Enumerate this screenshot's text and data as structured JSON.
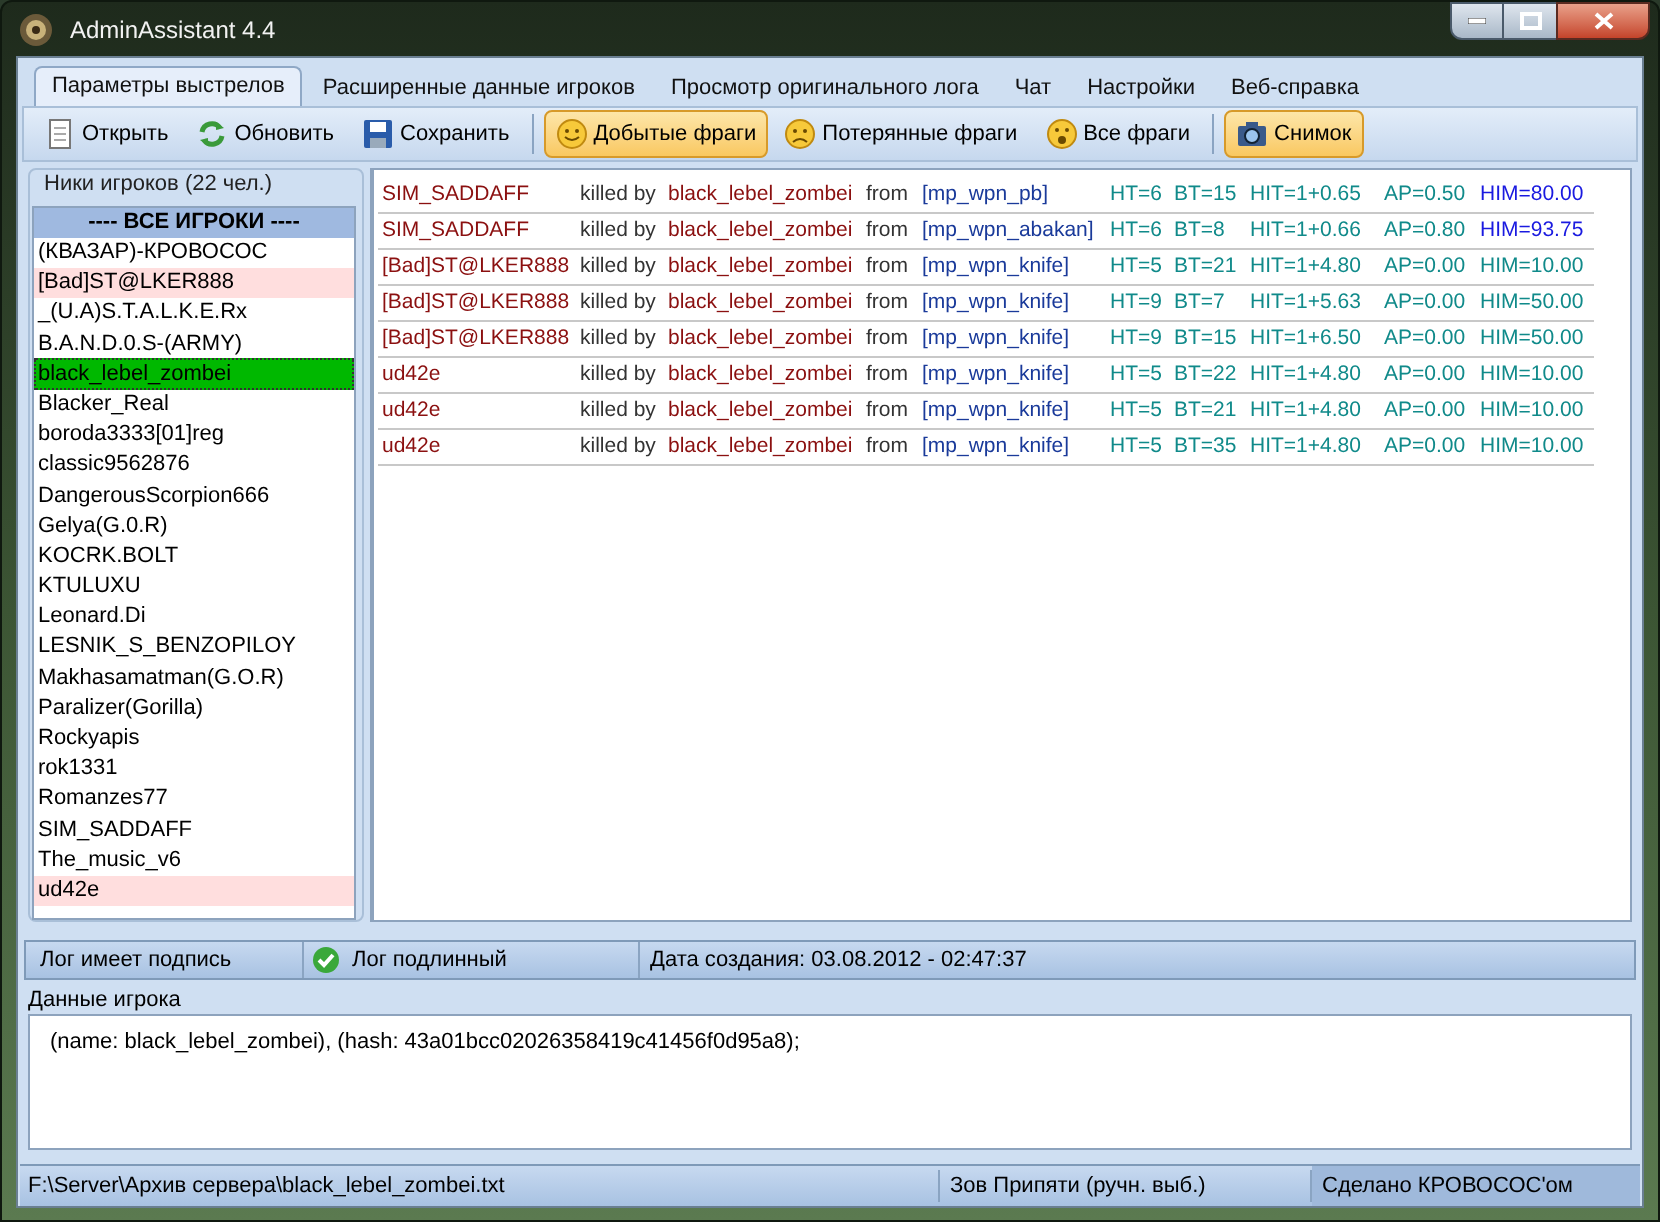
{
  "window": {
    "title": "AdminAssistant 4.4"
  },
  "tabs": [
    {
      "label": "Параметры выстрелов",
      "selected": true
    },
    {
      "label": "Расширенные данные игроков",
      "selected": false
    },
    {
      "label": "Просмотр оригинального лога",
      "selected": false
    },
    {
      "label": "Чат",
      "selected": false
    },
    {
      "label": "Настройки",
      "selected": false
    },
    {
      "label": "Веб-справка",
      "selected": false
    }
  ],
  "toolbar": [
    [
      {
        "label": "Открыть",
        "on": false
      },
      {
        "label": "Обновить",
        "on": false
      },
      {
        "label": "Сохранить",
        "on": false
      }
    ],
    [
      {
        "label": "Добытые фраги",
        "on": true
      },
      {
        "label": "Потерянные фраги",
        "on": false
      },
      {
        "label": "Все фраги",
        "on": false
      }
    ],
    [
      {
        "label": "Снимок",
        "on": true
      }
    ]
  ],
  "players": {
    "title": "Ники игроков (22 чел.)",
    "items": [
      {
        "kind": "header",
        "name": "---- ВСЕ ИГРОКИ ----",
        "selected": false,
        "marked": false
      },
      {
        "kind": "player",
        "name": "(КВАЗАР)-КРОВОСОС",
        "selected": false,
        "marked": false
      },
      {
        "kind": "player",
        "name": "[Bad]ST@LKER888",
        "selected": false,
        "marked": true
      },
      {
        "kind": "player",
        "name": "_(U.A)S.T.A.L.K.E.Rx",
        "selected": false,
        "marked": false
      },
      {
        "kind": "player",
        "name": "B.A.N.D.0.S-(ARMY)",
        "selected": false,
        "marked": false
      },
      {
        "kind": "player",
        "name": "black_lebel_zombei",
        "selected": true,
        "marked": false
      },
      {
        "kind": "player",
        "name": "Blacker_Real",
        "selected": false,
        "marked": false
      },
      {
        "kind": "player",
        "name": "boroda3333[01]reg",
        "selected": false,
        "marked": false
      },
      {
        "kind": "player",
        "name": "classic9562876",
        "selected": false,
        "marked": false
      },
      {
        "kind": "player",
        "name": "DangerousScorpion666",
        "selected": false,
        "marked": false
      },
      {
        "kind": "player",
        "name": "Gelya(G.0.R)",
        "selected": false,
        "marked": false
      },
      {
        "kind": "player",
        "name": "KOCRK.BOLT",
        "selected": false,
        "marked": false
      },
      {
        "kind": "player",
        "name": "KTULUXU",
        "selected": false,
        "marked": false
      },
      {
        "kind": "player",
        "name": "Leonard.Di",
        "selected": false,
        "marked": false
      },
      {
        "kind": "player",
        "name": "LESNIK_S_BENZOPILOY",
        "selected": false,
        "marked": false
      },
      {
        "kind": "player",
        "name": "Makhasamatman(G.O.R)",
        "selected": false,
        "marked": false
      },
      {
        "kind": "player",
        "name": "Paralizer(Gorilla)",
        "selected": false,
        "marked": false
      },
      {
        "kind": "player",
        "name": "Rockyapis",
        "selected": false,
        "marked": false
      },
      {
        "kind": "player",
        "name": "rok1331",
        "selected": false,
        "marked": false
      },
      {
        "kind": "player",
        "name": "Romanzes77",
        "selected": false,
        "marked": false
      },
      {
        "kind": "player",
        "name": "SIM_SADDAFF",
        "selected": false,
        "marked": false
      },
      {
        "kind": "player",
        "name": "The_music_v6",
        "selected": false,
        "marked": false
      },
      {
        "kind": "player",
        "name": "ud42e",
        "selected": false,
        "marked": true
      }
    ]
  },
  "log": [
    {
      "victim": "SIM_SADDAFF",
      "verb": "killed by",
      "killer": "black_lebel_zombei",
      "from": "from",
      "weapon": "[mp_wpn_pb]",
      "ht": "HT=6",
      "bt": "BT=15",
      "hit": "HIT=1+0.65",
      "ap": "AP=0.50",
      "him": "HIM=80.00",
      "alert": true
    },
    {
      "victim": "SIM_SADDAFF",
      "verb": "killed by",
      "killer": "black_lebel_zombei",
      "from": "from",
      "weapon": "[mp_wpn_abakan]",
      "ht": "HT=6",
      "bt": "BT=8",
      "hit": "HIT=1+0.66",
      "ap": "AP=0.80",
      "him": "HIM=93.75",
      "alert": true
    },
    {
      "victim": "[Bad]ST@LKER888",
      "verb": "killed by",
      "killer": "black_lebel_zombei",
      "from": "from",
      "weapon": "[mp_wpn_knife]",
      "ht": "HT=5",
      "bt": "BT=21",
      "hit": "HIT=1+4.80",
      "ap": "AP=0.00",
      "him": "HIM=10.00",
      "alert": false
    },
    {
      "victim": "[Bad]ST@LKER888",
      "verb": "killed by",
      "killer": "black_lebel_zombei",
      "from": "from",
      "weapon": "[mp_wpn_knife]",
      "ht": "HT=9",
      "bt": "BT=7",
      "hit": "HIT=1+5.63",
      "ap": "AP=0.00",
      "him": "HIM=50.00",
      "alert": false
    },
    {
      "victim": "[Bad]ST@LKER888",
      "verb": "killed by",
      "killer": "black_lebel_zombei",
      "from": "from",
      "weapon": "[mp_wpn_knife]",
      "ht": "HT=9",
      "bt": "BT=15",
      "hit": "HIT=1+6.50",
      "ap": "AP=0.00",
      "him": "HIM=50.00",
      "alert": false
    },
    {
      "victim": "ud42e",
      "verb": "killed by",
      "killer": "black_lebel_zombei",
      "from": "from",
      "weapon": "[mp_wpn_knife]",
      "ht": "HT=5",
      "bt": "BT=22",
      "hit": "HIT=1+4.80",
      "ap": "AP=0.00",
      "him": "HIM=10.00",
      "alert": false
    },
    {
      "victim": "ud42e",
      "verb": "killed by",
      "killer": "black_lebel_zombei",
      "from": "from",
      "weapon": "[mp_wpn_knife]",
      "ht": "HT=5",
      "bt": "BT=21",
      "hit": "HIT=1+4.80",
      "ap": "AP=0.00",
      "him": "HIM=10.00",
      "alert": false
    },
    {
      "victim": "ud42e",
      "verb": "killed by",
      "killer": "black_lebel_zombei",
      "from": "from",
      "weapon": "[mp_wpn_knife]",
      "ht": "HT=5",
      "bt": "BT=35",
      "hit": "HIT=1+4.80",
      "ap": "AP=0.00",
      "him": "HIM=10.00",
      "alert": false
    }
  ],
  "log_status": {
    "signed": "Лог имеет подпись",
    "authentic": "Лог подлинный",
    "verified": true,
    "created": "Дата создания: 03.08.2012 - 02:47:37"
  },
  "player_data": {
    "title": "Данные игрока",
    "text": "(name: black_lebel_zombei), (hash: 43a01bcc02026358419c41456f0d95a8);"
  },
  "status_bar": {
    "path": "F:\\Server\\Архив сервера\\black_lebel_zombei.txt",
    "game": "Зов Припяти (ручн. выб.)",
    "credit": "Сделано КРОВОСОС'ом"
  }
}
